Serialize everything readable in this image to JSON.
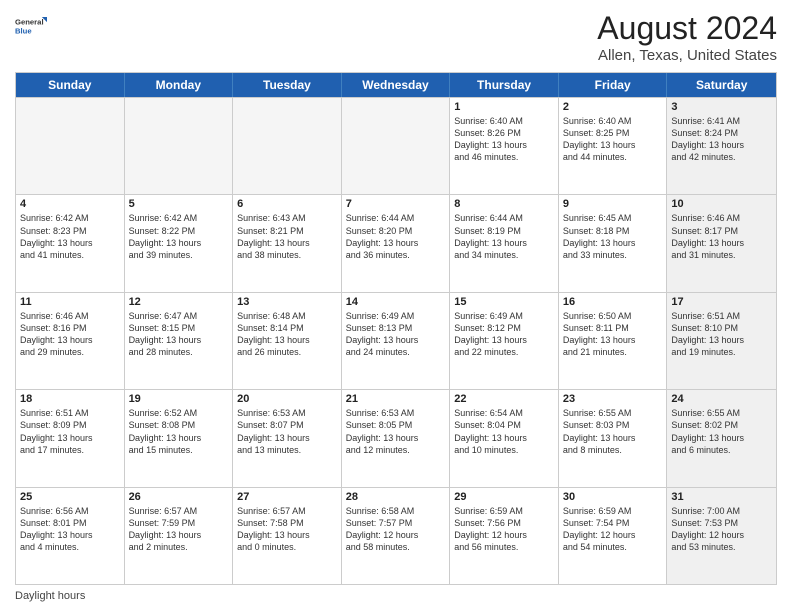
{
  "logo": {
    "general": "General",
    "blue": "Blue"
  },
  "title": "August 2024",
  "subtitle": "Allen, Texas, United States",
  "days_of_week": [
    "Sunday",
    "Monday",
    "Tuesday",
    "Wednesday",
    "Thursday",
    "Friday",
    "Saturday"
  ],
  "footer_text": "Daylight hours",
  "weeks": [
    [
      {
        "day": "",
        "content": "",
        "empty": true
      },
      {
        "day": "",
        "content": "",
        "empty": true
      },
      {
        "day": "",
        "content": "",
        "empty": true
      },
      {
        "day": "",
        "content": "",
        "empty": true
      },
      {
        "day": "1",
        "content": "Sunrise: 6:40 AM\nSunset: 8:26 PM\nDaylight: 13 hours\nand 46 minutes.",
        "empty": false
      },
      {
        "day": "2",
        "content": "Sunrise: 6:40 AM\nSunset: 8:25 PM\nDaylight: 13 hours\nand 44 minutes.",
        "empty": false
      },
      {
        "day": "3",
        "content": "Sunrise: 6:41 AM\nSunset: 8:24 PM\nDaylight: 13 hours\nand 42 minutes.",
        "empty": false,
        "shaded": true
      }
    ],
    [
      {
        "day": "4",
        "content": "Sunrise: 6:42 AM\nSunset: 8:23 PM\nDaylight: 13 hours\nand 41 minutes.",
        "empty": false
      },
      {
        "day": "5",
        "content": "Sunrise: 6:42 AM\nSunset: 8:22 PM\nDaylight: 13 hours\nand 39 minutes.",
        "empty": false
      },
      {
        "day": "6",
        "content": "Sunrise: 6:43 AM\nSunset: 8:21 PM\nDaylight: 13 hours\nand 38 minutes.",
        "empty": false
      },
      {
        "day": "7",
        "content": "Sunrise: 6:44 AM\nSunset: 8:20 PM\nDaylight: 13 hours\nand 36 minutes.",
        "empty": false
      },
      {
        "day": "8",
        "content": "Sunrise: 6:44 AM\nSunset: 8:19 PM\nDaylight: 13 hours\nand 34 minutes.",
        "empty": false
      },
      {
        "day": "9",
        "content": "Sunrise: 6:45 AM\nSunset: 8:18 PM\nDaylight: 13 hours\nand 33 minutes.",
        "empty": false
      },
      {
        "day": "10",
        "content": "Sunrise: 6:46 AM\nSunset: 8:17 PM\nDaylight: 13 hours\nand 31 minutes.",
        "empty": false,
        "shaded": true
      }
    ],
    [
      {
        "day": "11",
        "content": "Sunrise: 6:46 AM\nSunset: 8:16 PM\nDaylight: 13 hours\nand 29 minutes.",
        "empty": false
      },
      {
        "day": "12",
        "content": "Sunrise: 6:47 AM\nSunset: 8:15 PM\nDaylight: 13 hours\nand 28 minutes.",
        "empty": false
      },
      {
        "day": "13",
        "content": "Sunrise: 6:48 AM\nSunset: 8:14 PM\nDaylight: 13 hours\nand 26 minutes.",
        "empty": false
      },
      {
        "day": "14",
        "content": "Sunrise: 6:49 AM\nSunset: 8:13 PM\nDaylight: 13 hours\nand 24 minutes.",
        "empty": false
      },
      {
        "day": "15",
        "content": "Sunrise: 6:49 AM\nSunset: 8:12 PM\nDaylight: 13 hours\nand 22 minutes.",
        "empty": false
      },
      {
        "day": "16",
        "content": "Sunrise: 6:50 AM\nSunset: 8:11 PM\nDaylight: 13 hours\nand 21 minutes.",
        "empty": false
      },
      {
        "day": "17",
        "content": "Sunrise: 6:51 AM\nSunset: 8:10 PM\nDaylight: 13 hours\nand 19 minutes.",
        "empty": false,
        "shaded": true
      }
    ],
    [
      {
        "day": "18",
        "content": "Sunrise: 6:51 AM\nSunset: 8:09 PM\nDaylight: 13 hours\nand 17 minutes.",
        "empty": false
      },
      {
        "day": "19",
        "content": "Sunrise: 6:52 AM\nSunset: 8:08 PM\nDaylight: 13 hours\nand 15 minutes.",
        "empty": false
      },
      {
        "day": "20",
        "content": "Sunrise: 6:53 AM\nSunset: 8:07 PM\nDaylight: 13 hours\nand 13 minutes.",
        "empty": false
      },
      {
        "day": "21",
        "content": "Sunrise: 6:53 AM\nSunset: 8:05 PM\nDaylight: 13 hours\nand 12 minutes.",
        "empty": false
      },
      {
        "day": "22",
        "content": "Sunrise: 6:54 AM\nSunset: 8:04 PM\nDaylight: 13 hours\nand 10 minutes.",
        "empty": false
      },
      {
        "day": "23",
        "content": "Sunrise: 6:55 AM\nSunset: 8:03 PM\nDaylight: 13 hours\nand 8 minutes.",
        "empty": false
      },
      {
        "day": "24",
        "content": "Sunrise: 6:55 AM\nSunset: 8:02 PM\nDaylight: 13 hours\nand 6 minutes.",
        "empty": false,
        "shaded": true
      }
    ],
    [
      {
        "day": "25",
        "content": "Sunrise: 6:56 AM\nSunset: 8:01 PM\nDaylight: 13 hours\nand 4 minutes.",
        "empty": false
      },
      {
        "day": "26",
        "content": "Sunrise: 6:57 AM\nSunset: 7:59 PM\nDaylight: 13 hours\nand 2 minutes.",
        "empty": false
      },
      {
        "day": "27",
        "content": "Sunrise: 6:57 AM\nSunset: 7:58 PM\nDaylight: 13 hours\nand 0 minutes.",
        "empty": false
      },
      {
        "day": "28",
        "content": "Sunrise: 6:58 AM\nSunset: 7:57 PM\nDaylight: 12 hours\nand 58 minutes.",
        "empty": false
      },
      {
        "day": "29",
        "content": "Sunrise: 6:59 AM\nSunset: 7:56 PM\nDaylight: 12 hours\nand 56 minutes.",
        "empty": false
      },
      {
        "day": "30",
        "content": "Sunrise: 6:59 AM\nSunset: 7:54 PM\nDaylight: 12 hours\nand 54 minutes.",
        "empty": false
      },
      {
        "day": "31",
        "content": "Sunrise: 7:00 AM\nSunset: 7:53 PM\nDaylight: 12 hours\nand 53 minutes.",
        "empty": false,
        "shaded": true
      }
    ]
  ]
}
